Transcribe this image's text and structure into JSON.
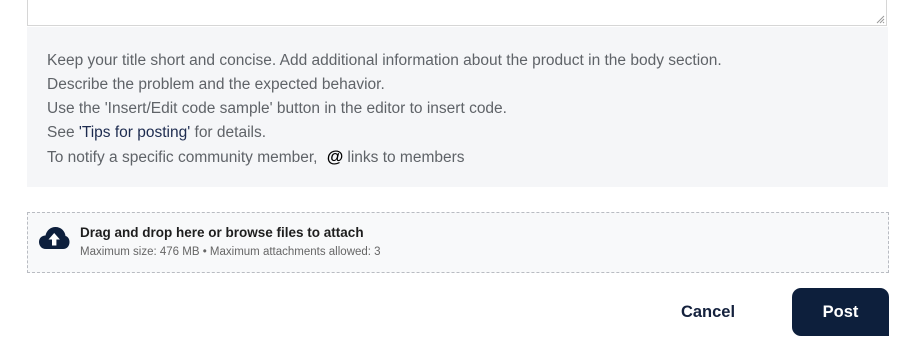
{
  "tips": {
    "line1": "Keep your title short and concise. Add additional information about the product in the body section.",
    "line2": "Describe the problem and the expected behavior.",
    "line3": "Use the 'Insert/Edit code sample' button in the editor to insert code.",
    "line4_prefix": "See ",
    "line4_link": "'Tips for posting'",
    "line4_suffix": " for details.",
    "line5_prefix": "To notify a specific community member, ",
    "line5_icon": "@",
    "line5_suffix": "links to members"
  },
  "attachments": {
    "icon": "cloud-upload-icon",
    "drag_text_prefix": "Drag and drop here or ",
    "browse_label": "browse",
    "drag_text_suffix": " files to attach",
    "limits": "Maximum size: 476 MB • Maximum attachments allowed: 3"
  },
  "actions": {
    "cancel_label": "Cancel",
    "post_label": "Post"
  },
  "colors": {
    "primary": "#0d1f3c",
    "tips_background": "#f5f6f8",
    "link": "#1d2b4f"
  }
}
